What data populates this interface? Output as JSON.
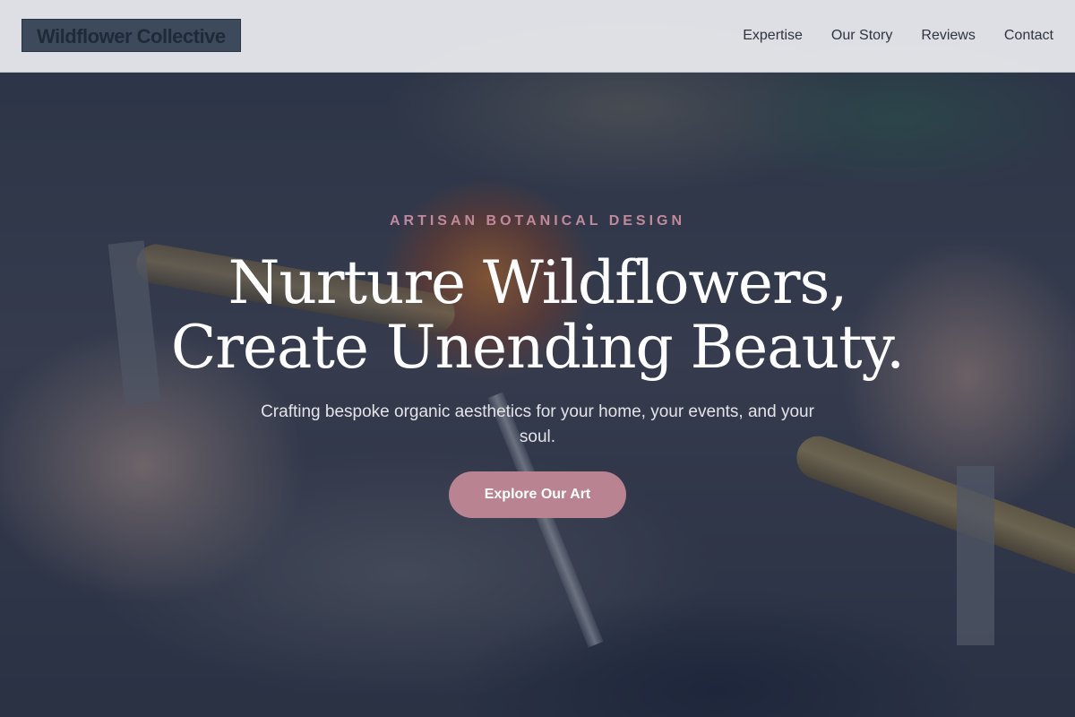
{
  "brand": {
    "logo_text": "Wildflower Collective"
  },
  "nav": {
    "items": [
      {
        "label": "Expertise"
      },
      {
        "label": "Our Story"
      },
      {
        "label": "Reviews"
      },
      {
        "label": "Contact"
      }
    ]
  },
  "hero": {
    "eyebrow": "ARTISAN BOTANICAL DESIGN",
    "headline_line1": "Nurture Wildflowers,",
    "headline_line2": "Create Unending Beauty.",
    "subtext": "Crafting bespoke organic aesthetics for your home, your events, and your soul.",
    "cta_label": "Explore Our Art"
  },
  "colors": {
    "accent": "#b98391",
    "eyebrow": "#c08a9b",
    "nav_bg": "#eceef0",
    "logo_bg": "#3d4a5c",
    "overlay": "#1e283e"
  }
}
